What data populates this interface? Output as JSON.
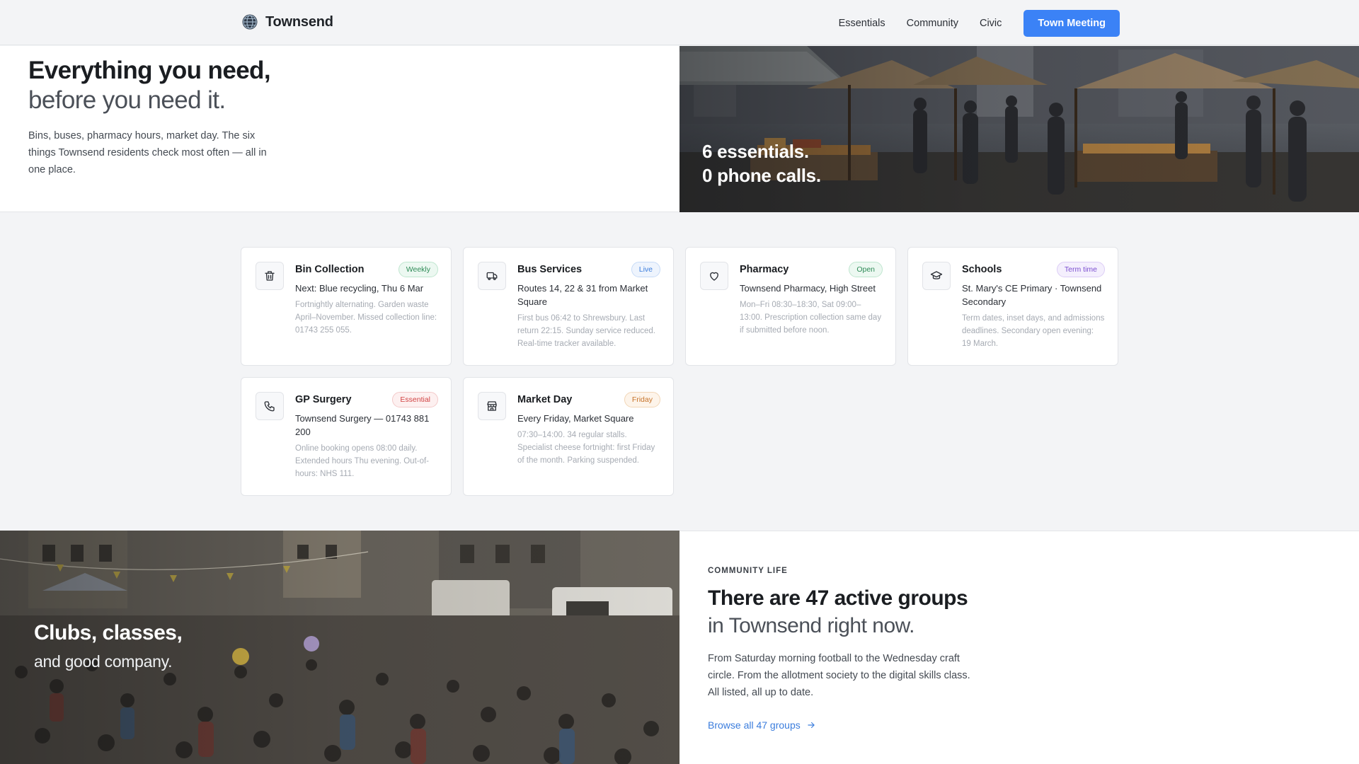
{
  "brand": {
    "name": "Townsend",
    "icon": "globe-icon"
  },
  "nav": {
    "links": [
      "Essentials",
      "Community",
      "Civic"
    ],
    "cta": "Town Meeting"
  },
  "hero": {
    "title": "Everything you need,",
    "subtitle": "before you need it.",
    "description": "Bins, buses, pharmacy hours, market day. The six things Townsend residents check most often — all in one place.",
    "caption_line1": "6 essentials.",
    "caption_line2": "0 phone calls."
  },
  "cards": [
    {
      "icon": "trash-icon",
      "title": "Bin Collection",
      "badge": "Weekly",
      "badge_color": "green",
      "main": "Next: Blue recycling, Thu 6 Mar",
      "detail": "Fortnightly alternating. Garden waste April–November. Missed collection line: 01743 255 055."
    },
    {
      "icon": "bus-icon",
      "title": "Bus Services",
      "badge": "Live",
      "badge_color": "blue",
      "main": "Routes 14, 22 & 31 from Market Square",
      "detail": "First bus 06:42 to Shrewsbury. Last return 22:15. Sunday service reduced. Real-time tracker available."
    },
    {
      "icon": "heart-icon",
      "title": "Pharmacy",
      "badge": "Open",
      "badge_color": "green",
      "main": "Townsend Pharmacy, High Street",
      "detail": "Mon–Fri 08:30–18:30, Sat 09:00–13:00. Prescription collection same day if submitted before noon."
    },
    {
      "icon": "graduation-cap-icon",
      "title": "Schools",
      "badge": "Term time",
      "badge_color": "purple",
      "main": "St. Mary's CE Primary · Townsend Secondary",
      "detail": "Term dates, inset days, and admissions deadlines. Secondary open evening: 19 March."
    },
    {
      "icon": "phone-icon",
      "title": "GP Surgery",
      "badge": "Essential",
      "badge_color": "red",
      "main": "Townsend Surgery — 01743 881 200",
      "detail": "Online booking opens 08:00 daily. Extended hours Thu evening. Out-of-hours: NHS 111."
    },
    {
      "icon": "store-icon",
      "title": "Market Day",
      "badge": "Friday",
      "badge_color": "orange",
      "main": "Every Friday, Market Square",
      "detail": "07:30–14:00. 34 regular stalls. Specialist cheese fortnight: first Friday of the month. Parking suspended."
    }
  ],
  "community": {
    "caption_line1": "Clubs, classes,",
    "caption_line2": "and good company.",
    "eyebrow": "COMMUNITY LIFE",
    "title": "There are 47 active groups",
    "subtitle": "in Townsend right now.",
    "description": "From Saturday morning football to the Wednesday craft circle. From the allotment society to the digital skills class. All listed, all up to date.",
    "link": "Browse all 47 groups",
    "link_icon": "arrow-right-icon"
  },
  "colors": {
    "accent": "#3b82f6",
    "link": "#3b7ddd",
    "page_bg": "#f3f4f6"
  }
}
